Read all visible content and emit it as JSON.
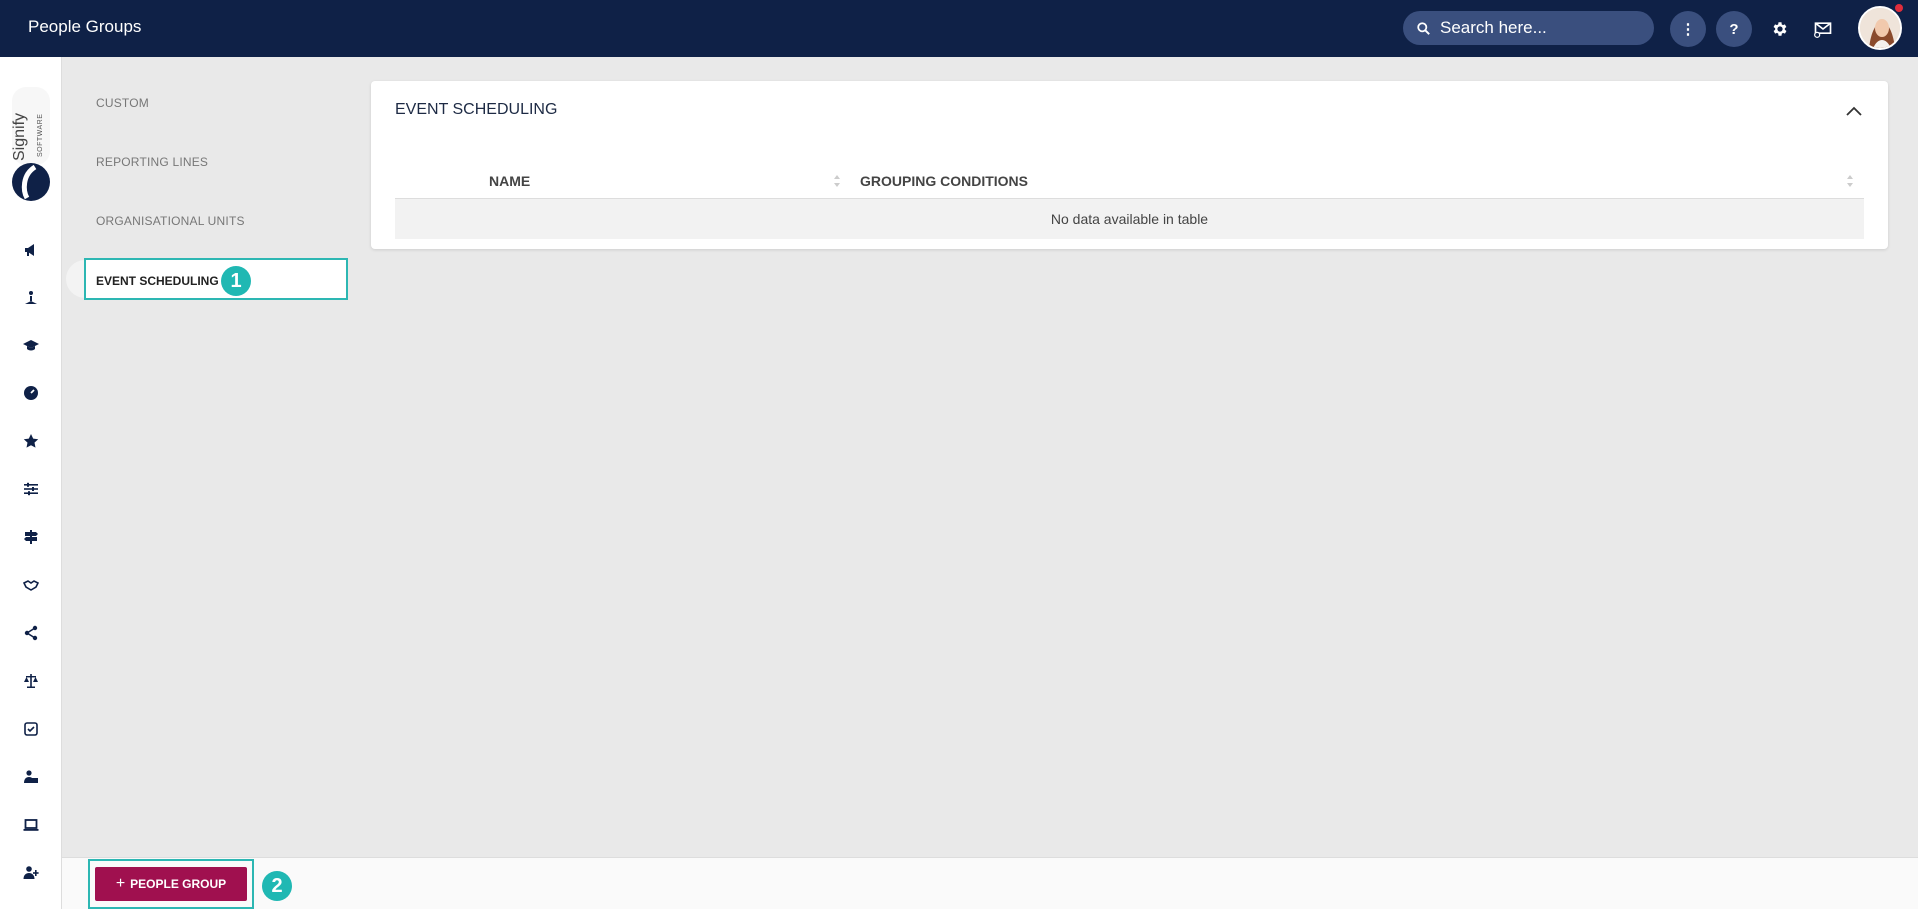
{
  "header": {
    "title": "People Groups",
    "search_placeholder": "Search here...",
    "more_label": "⋮",
    "help_label": "?"
  },
  "sidebar": {
    "brand_text": "Signify",
    "brand_sub": "SOFTWARE",
    "icons": [
      "megaphone-icon",
      "person-meditate-icon",
      "graduation-cap-icon",
      "gauge-icon",
      "star-icon",
      "sliders-icon",
      "signpost-icon",
      "handshake-icon",
      "diagram-icon",
      "scales-icon",
      "checkbox-icon",
      "user-briefcase-icon",
      "laptop-icon",
      "user-plus-icon"
    ]
  },
  "subnav": {
    "items": [
      {
        "label": "CUSTOM"
      },
      {
        "label": "REPORTING LINES"
      },
      {
        "label": "ORGANISATIONAL UNITS"
      }
    ],
    "active": "EVENT SCHEDULING",
    "marker": "1"
  },
  "card": {
    "title": "EVENT SCHEDULING",
    "columns": [
      "NAME",
      "GROUPING CONDITIONS"
    ],
    "empty_text": "No data available in table"
  },
  "footer": {
    "add_label": "PEOPLE GROUP",
    "marker": "2"
  },
  "colors": {
    "topbar": "#0f2147",
    "accent": "#a0104f",
    "highlight": "#2db7b3"
  }
}
